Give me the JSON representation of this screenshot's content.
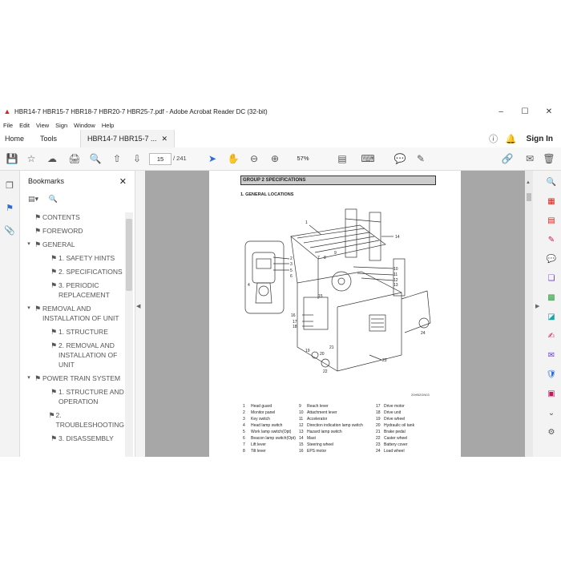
{
  "window": {
    "title": "HBR14-7 HBR15-7 HBR18-7 HBR20-7 HBR25-7.pdf - Adobe Acrobat Reader DC (32-bit)",
    "controls": {
      "minimize": "–",
      "maximize": "☐",
      "close": "✕"
    }
  },
  "menu": [
    "File",
    "Edit",
    "View",
    "Sign",
    "Window",
    "Help"
  ],
  "tabs": {
    "home": "Home",
    "tools": "Tools",
    "document": "HBR14-7 HBR15-7 ...",
    "close": "✕",
    "sign_in": "Sign In"
  },
  "toolbar": {
    "page_current": "15",
    "page_total": "/ 241",
    "zoom": "57%"
  },
  "bookmarks": {
    "header": "Bookmarks",
    "close": "✕",
    "items": [
      {
        "label": "CONTENTS",
        "level": 0,
        "chevron": ""
      },
      {
        "label": "FOREWORD",
        "level": 0,
        "chevron": ""
      },
      {
        "label": "GENERAL",
        "level": 0,
        "chevron": "▾"
      },
      {
        "label": "1. SAFETY HINTS",
        "level": 1,
        "chevron": ""
      },
      {
        "label": "2. SPECIFICATIONS",
        "level": 1,
        "chevron": ""
      },
      {
        "label": "3. PERIODIC REPLACEMENT",
        "level": 1,
        "chevron": ""
      },
      {
        "label": "REMOVAL AND INSTALLATION OF UNIT",
        "level": 0,
        "chevron": "▾"
      },
      {
        "label": "1. STRUCTURE",
        "level": 1,
        "chevron": ""
      },
      {
        "label": "2. REMOVAL AND INSTALLATION OF UNIT",
        "level": 1,
        "chevron": ""
      },
      {
        "label": "POWER TRAIN SYSTEM",
        "level": 0,
        "chevron": "▾"
      },
      {
        "label": "1. STRUCTURE AND OPERATION",
        "level": 1,
        "chevron": ""
      },
      {
        "label": "2. TROUBLESHOOTING",
        "level": 1,
        "chevron": ""
      },
      {
        "label": "3. DISASSEMBLY",
        "level": 1,
        "chevron": ""
      }
    ]
  },
  "document": {
    "group_title": "GROUP 2  SPECIFICATIONS",
    "section_title": "1. GENERAL LOCATIONS",
    "drawing_code": "20HB2GN03",
    "callouts": [
      "1",
      "2",
      "3",
      "4",
      "5",
      "6",
      "7",
      "8",
      "9",
      "10",
      "11",
      "12",
      "13",
      "14",
      "15",
      "16",
      "17",
      "18",
      "19",
      "20",
      "21",
      "22",
      "23",
      "24"
    ],
    "legend": [
      [
        "1",
        "Head guard",
        "9",
        "Reach lever",
        "17",
        "Drive motor"
      ],
      [
        "2",
        "Monitor panel",
        "10",
        "Attachment lever",
        "18",
        "Drive unit"
      ],
      [
        "3",
        "Key switch",
        "11",
        "Accelerator",
        "19",
        "Drive wheel"
      ],
      [
        "4",
        "Head lamp switch",
        "12",
        "Direction indication lamp switch",
        "20",
        "Hydraulic oil tank"
      ],
      [
        "5",
        "Work lamp switch(Opt)",
        "13",
        "Hazard lamp switch",
        "21",
        "Brake pedal"
      ],
      [
        "6",
        "Beacon lamp switch(Opt)",
        "14",
        "Mast",
        "22",
        "Caster wheel"
      ],
      [
        "7",
        "Lift lever",
        "15",
        "Steering wheel",
        "23",
        "Battery cover"
      ],
      [
        "8",
        "Tilt lever",
        "16",
        "EPS motor",
        "24",
        "Load wheel"
      ]
    ]
  },
  "colors": {
    "doc_bg": "#a7a7a7",
    "accent_blue": "#2b6cd4",
    "pdf_red": "#d4251b"
  }
}
